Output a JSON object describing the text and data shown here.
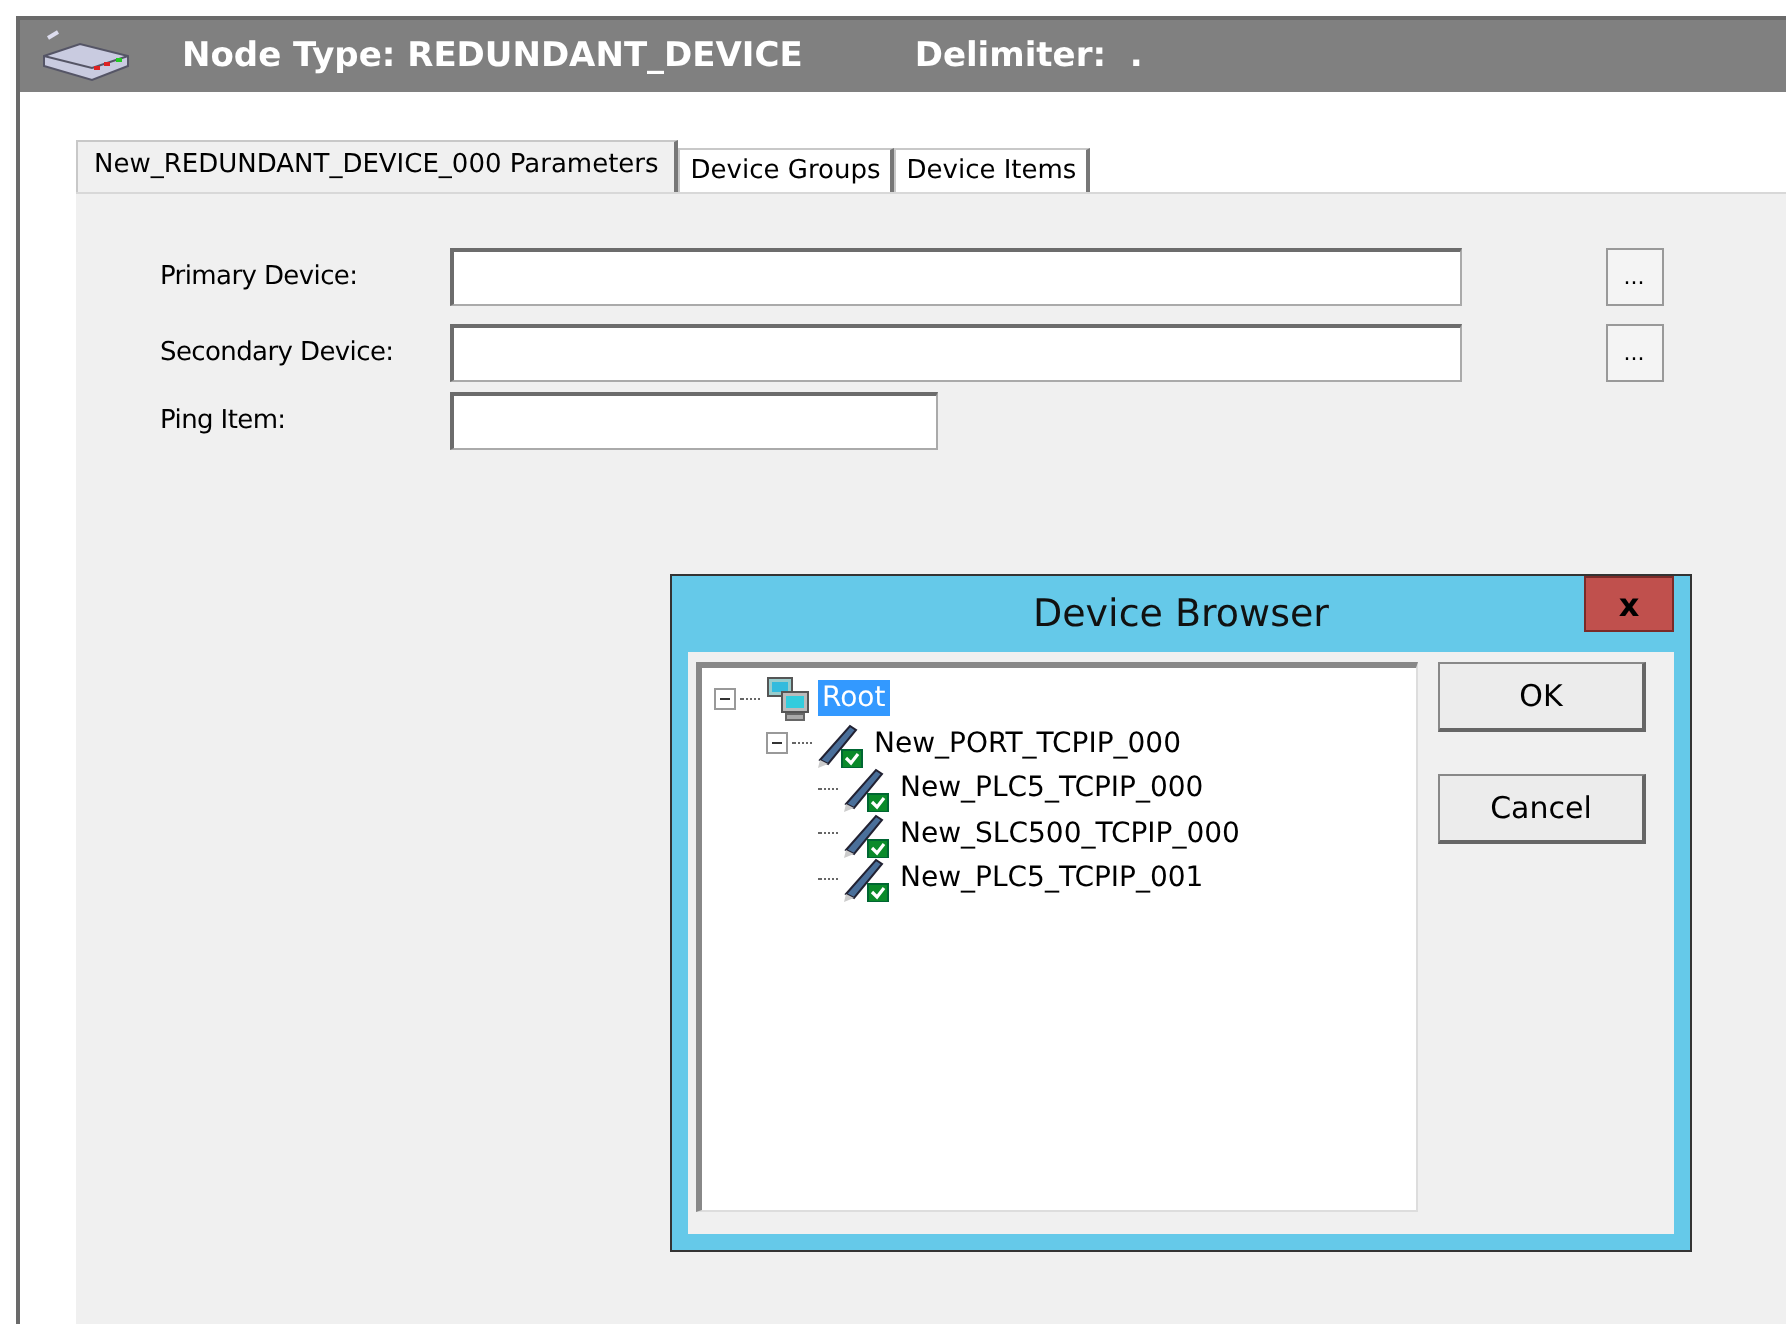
{
  "header": {
    "node_type": "Node Type: REDUNDANT_DEVICE",
    "delimiter": "Delimiter:  ."
  },
  "tabs": [
    {
      "label": "New_REDUNDANT_DEVICE_000 Parameters",
      "selected": true
    },
    {
      "label": "Device Groups",
      "selected": false
    },
    {
      "label": "Device Items",
      "selected": false
    }
  ],
  "fields": [
    {
      "label": "Primary Device:",
      "browse": "..."
    },
    {
      "label": "Secondary Device:",
      "browse": "..."
    },
    {
      "label": "Ping Item:"
    }
  ],
  "dialog": {
    "title": "Device Browser",
    "close": "x",
    "tree": [
      {
        "label": "Root",
        "kind": "root",
        "selected": true,
        "expanded": true,
        "children": [
          {
            "label": "New_PORT_TCPIP_000",
            "kind": "device",
            "selected": false,
            "expanded": true,
            "children": [
              {
                "label": "New_PLC5_TCPIP_000",
                "kind": "device",
                "selected": false
              },
              {
                "label": "New_SLC500_TCPIP_000",
                "kind": "device",
                "selected": false
              },
              {
                "label": "New_PLC5_TCPIP_001",
                "kind": "device",
                "selected": false
              }
            ]
          }
        ]
      }
    ],
    "buttons": [
      "OK",
      "Cancel"
    ]
  }
}
